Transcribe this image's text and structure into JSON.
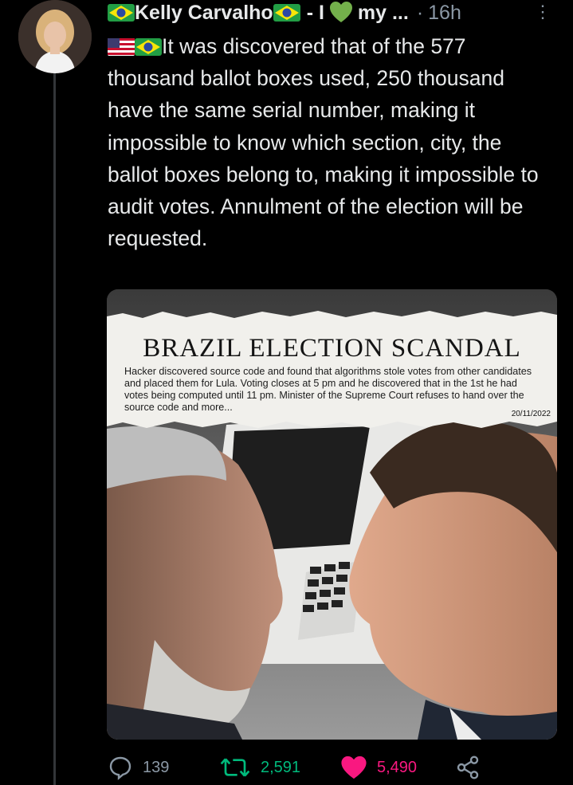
{
  "tweet": {
    "author_name": "Kelly Carvalho",
    "author_suffix": "- I",
    "author_suffix2": "my ...",
    "separator": "·",
    "time": "16h",
    "text": "It was discovered that of the 577 thousand ballot boxes used, 250 thousand have the same serial number, making it impossible to know which section, city, the ballot boxes belong to, making it impossible to audit votes. Annulment of the election will be requested."
  },
  "image": {
    "headline": "BRAZIL ELECTION SCANDAL",
    "blurb": "Hacker discovered source code and found that algorithms stole votes from other candidates and placed them for Lula. Voting closes at 5 pm and he discovered that in the 1st he had votes being computed until 11 pm. Minister of the Supreme Court refuses to hand over the source code and more...",
    "date": "20/11/2022"
  },
  "actions": {
    "replies": "139",
    "retweets": "2,591",
    "likes": "5,490"
  },
  "colors": {
    "background": "#000000",
    "text": "#e7e9ea",
    "muted": "#8b98a5",
    "retweet": "#00ba7c",
    "like": "#f91880"
  }
}
